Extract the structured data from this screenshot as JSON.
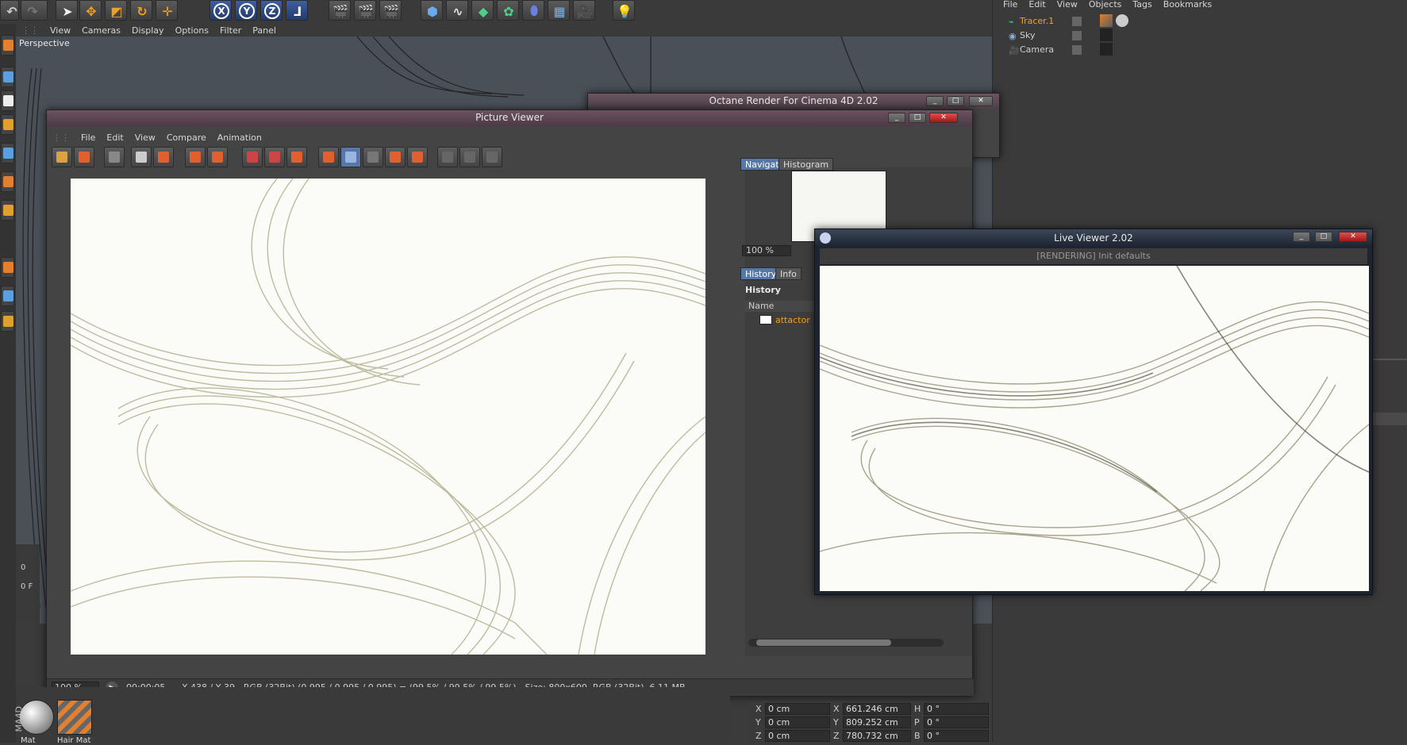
{
  "top_toolbar": {
    "axis_buttons": [
      "X",
      "Y",
      "Z"
    ]
  },
  "viewport": {
    "menu": [
      "View",
      "Cameras",
      "Display",
      "Options",
      "Filter",
      "Panel"
    ],
    "label": "Perspective",
    "timeline_values": [
      "0",
      "0 F"
    ]
  },
  "object_manager": {
    "menu": [
      "File",
      "Edit",
      "View",
      "Objects",
      "Tags",
      "Bookmarks"
    ],
    "objects": [
      {
        "name": "Tracer.1",
        "color": "#f0a020"
      },
      {
        "name": "Sky",
        "color": "#d0d0d0"
      },
      {
        "name": "Camera",
        "color": "#d0d0d0"
      }
    ]
  },
  "octane_window": {
    "title": "Octane Render For Cinema 4D 2.02"
  },
  "picture_viewer": {
    "title": "Picture Viewer",
    "menu": [
      "File",
      "Edit",
      "View",
      "Compare",
      "Animation"
    ],
    "tabs_top": [
      "Navigator",
      "Histogram"
    ],
    "nav_zoom": "100 %",
    "tabs_bottom": [
      "History",
      "Info"
    ],
    "history_header": "History",
    "column_name": "Name",
    "history_item": "attactor",
    "zoom": "100 %",
    "time": "00:00:05",
    "status": "X 438 / Y 39 - RGB (32Bit) (0.995 / 0.995 / 0.995) = (99.5% / 99.5% / 99.5%) - Size: 800x600, RGB (32Bit), 6.11 MB"
  },
  "live_viewer": {
    "title": "Live Viewer 2.02",
    "status": "[RENDERING] Init defaults"
  },
  "coordinates": {
    "rows": [
      {
        "l1": "X",
        "v1": "0 cm",
        "l2": "X",
        "v2": "661.246 cm",
        "l3": "H",
        "v3": "0 °"
      },
      {
        "l1": "Y",
        "v1": "0 cm",
        "l2": "Y",
        "v2": "809.252 cm",
        "l3": "P",
        "v3": "0 °"
      },
      {
        "l1": "Z",
        "v1": "0 cm",
        "l2": "Z",
        "v2": "780.732 cm",
        "l3": "B",
        "v3": "0 °"
      }
    ]
  },
  "material_manager": {
    "materials": [
      "Mat",
      "Hair Mat"
    ],
    "brand": "MA4D"
  }
}
